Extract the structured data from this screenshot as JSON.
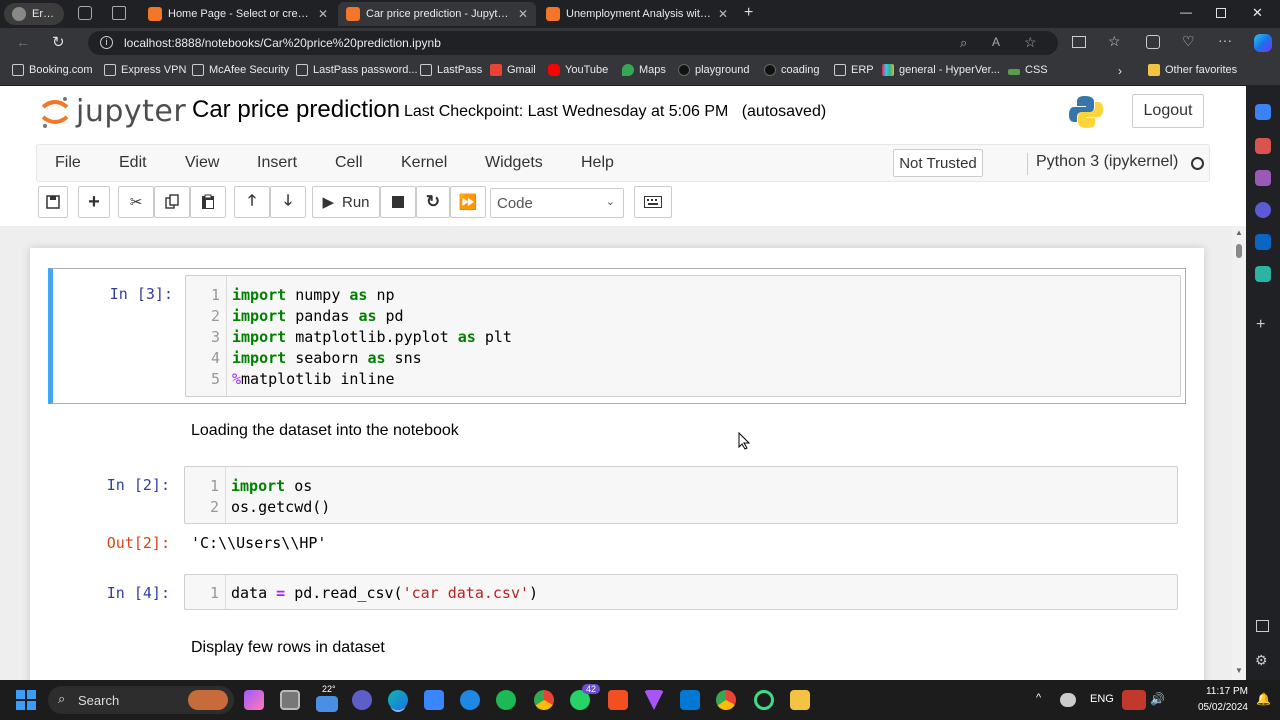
{
  "browser": {
    "tabs": [
      {
        "label": "Error",
        "kind": "profile"
      },
      {
        "label": "Home Page - Select or create a notebook"
      },
      {
        "label": "Car price prediction - Jupyter Notebook",
        "active": true
      },
      {
        "label": "Unemployment Analysis with python"
      }
    ],
    "url": "localhost:8888/notebooks/Car%20price%20prediction.ipynb",
    "bookmarks": [
      "Booking.com",
      "Express VPN",
      "McAfee Security",
      "LastPass password...",
      "LastPass",
      "Gmail",
      "YouTube",
      "Maps",
      "playground",
      "coading",
      "ERP",
      "general - HyperVer...",
      "CSS"
    ],
    "other_favorites": "Other favorites"
  },
  "jupyter": {
    "logo_text": "jupyter",
    "notebook_title": "Car price prediction",
    "checkpoint": "Last Checkpoint: Last Wednesday at 5:06 PM",
    "autosaved": "(autosaved)",
    "logout_label": "Logout",
    "menus": [
      "File",
      "Edit",
      "View",
      "Insert",
      "Cell",
      "Kernel",
      "Widgets",
      "Help"
    ],
    "trust_label": "Not Trusted",
    "kernel_name": "Python 3 (ipykernel)",
    "run_label": "Run",
    "cell_type": "Code"
  },
  "cells": [
    {
      "prompt": "In [3]:",
      "lines": [
        "1",
        "2",
        "3",
        "4",
        "5"
      ]
    },
    {
      "markdown": "Loading the dataset into the notebook"
    },
    {
      "prompt": "In [2]:",
      "lines": [
        "1",
        "2"
      ],
      "out_prompt": "Out[2]:",
      "output": "'C:\\\\Users\\\\HP'"
    },
    {
      "prompt": "In [4]:",
      "lines": [
        "1"
      ]
    },
    {
      "markdown": "Display few rows in dataset"
    }
  ],
  "taskbar": {
    "search_label": "Search",
    "lang": "ENG",
    "time": "11:17 PM",
    "date": "05/02/2024",
    "whatsapp_badge": "42",
    "weather": "22°"
  },
  "colors": {
    "jupyter_orange": "#f37726",
    "selected_cell": "#42a5f5",
    "keyword": "#008000",
    "prompt_in": "#303f9f",
    "prompt_out": "#d84315"
  }
}
